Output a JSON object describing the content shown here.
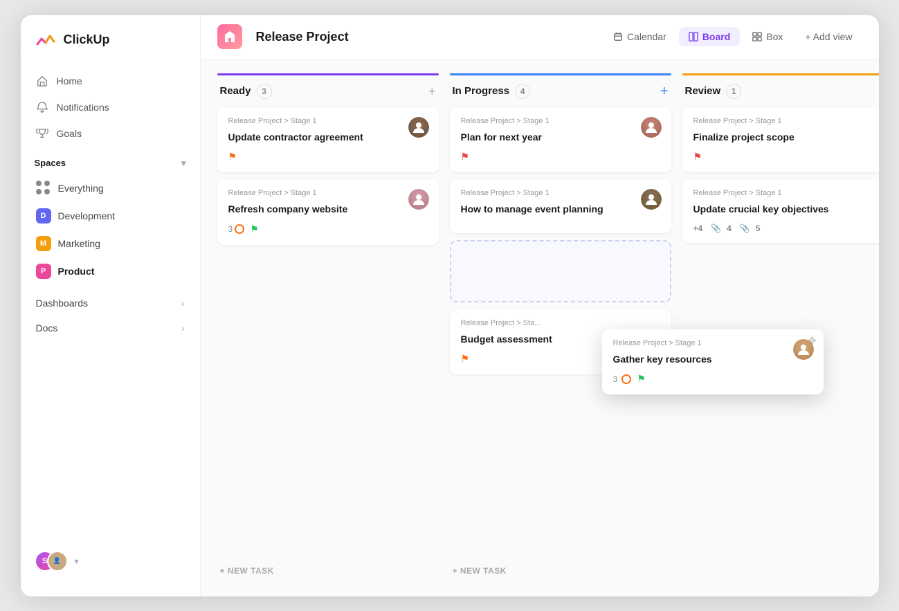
{
  "app": {
    "name": "ClickUp"
  },
  "sidebar": {
    "nav": [
      {
        "id": "home",
        "label": "Home",
        "icon": "home-icon"
      },
      {
        "id": "notifications",
        "label": "Notifications",
        "icon": "bell-icon"
      },
      {
        "id": "goals",
        "label": "Goals",
        "icon": "trophy-icon"
      }
    ],
    "spaces_label": "Spaces",
    "spaces": [
      {
        "id": "everything",
        "label": "Everything",
        "color": null,
        "letter": null
      },
      {
        "id": "development",
        "label": "Development",
        "color": "#6366f1",
        "letter": "D"
      },
      {
        "id": "marketing",
        "label": "Marketing",
        "color": "#f59e0b",
        "letter": "M"
      },
      {
        "id": "product",
        "label": "Product",
        "color": "#ec4899",
        "letter": "P",
        "active": true
      }
    ],
    "bottom": [
      {
        "id": "dashboards",
        "label": "Dashboards"
      },
      {
        "id": "docs",
        "label": "Docs"
      }
    ]
  },
  "header": {
    "project_name": "Release Project",
    "views": [
      {
        "id": "calendar",
        "label": "Calendar",
        "active": false
      },
      {
        "id": "board",
        "label": "Board",
        "active": true
      },
      {
        "id": "box",
        "label": "Box",
        "active": false
      }
    ],
    "add_view": "+ Add view"
  },
  "columns": [
    {
      "id": "ready",
      "title": "Ready",
      "count": 3,
      "bar_color": "purple",
      "cards": [
        {
          "id": "c1",
          "breadcrumb": "Release Project > Stage 1",
          "title": "Update contractor agreement",
          "flags": [
            "orange"
          ],
          "avatar_color": "face-1"
        },
        {
          "id": "c2",
          "breadcrumb": "Release Project > Stage 1",
          "title": "Refresh company website",
          "comments": 3,
          "flags": [
            "green"
          ],
          "avatar_color": "face-2"
        }
      ],
      "new_task_label": "+ NEW TASK"
    },
    {
      "id": "in-progress",
      "title": "In Progress",
      "count": 4,
      "bar_color": "blue",
      "cards": [
        {
          "id": "c3",
          "breadcrumb": "Release Project > Stage 1",
          "title": "Plan for next year",
          "flags": [
            "red"
          ],
          "avatar_color": "face-3"
        },
        {
          "id": "c4",
          "breadcrumb": "Release Project > Stage 1",
          "title": "How to manage event planning",
          "flags": [],
          "avatar_color": "face-4"
        },
        {
          "id": "c5-dashed",
          "dashed": true
        },
        {
          "id": "c6",
          "breadcrumb": "Release Project > Sta...",
          "title": "Budget assessment",
          "flags": [
            "orange"
          ],
          "avatar_color": null
        }
      ],
      "new_task_label": "+ NEW TASK"
    },
    {
      "id": "review",
      "title": "Review",
      "count": 1,
      "bar_color": "yellow",
      "cards": [
        {
          "id": "c7",
          "breadcrumb": "Release Project > Stage 1",
          "title": "Finalize project scope",
          "flags": [
            "red"
          ],
          "avatar_color": null
        },
        {
          "id": "c8",
          "breadcrumb": "Release Project > Stage 1",
          "title": "Update crucial key objectives",
          "extra_label": "+4",
          "attach_count_1": 4,
          "attach_count_2": 5,
          "avatar_color": null
        }
      ]
    }
  ],
  "dragging_card": {
    "breadcrumb": "Release Project > Stage 1",
    "title": "Gather key resources",
    "comments": 3,
    "flags": [
      "green"
    ],
    "avatar_color": "face-5"
  }
}
